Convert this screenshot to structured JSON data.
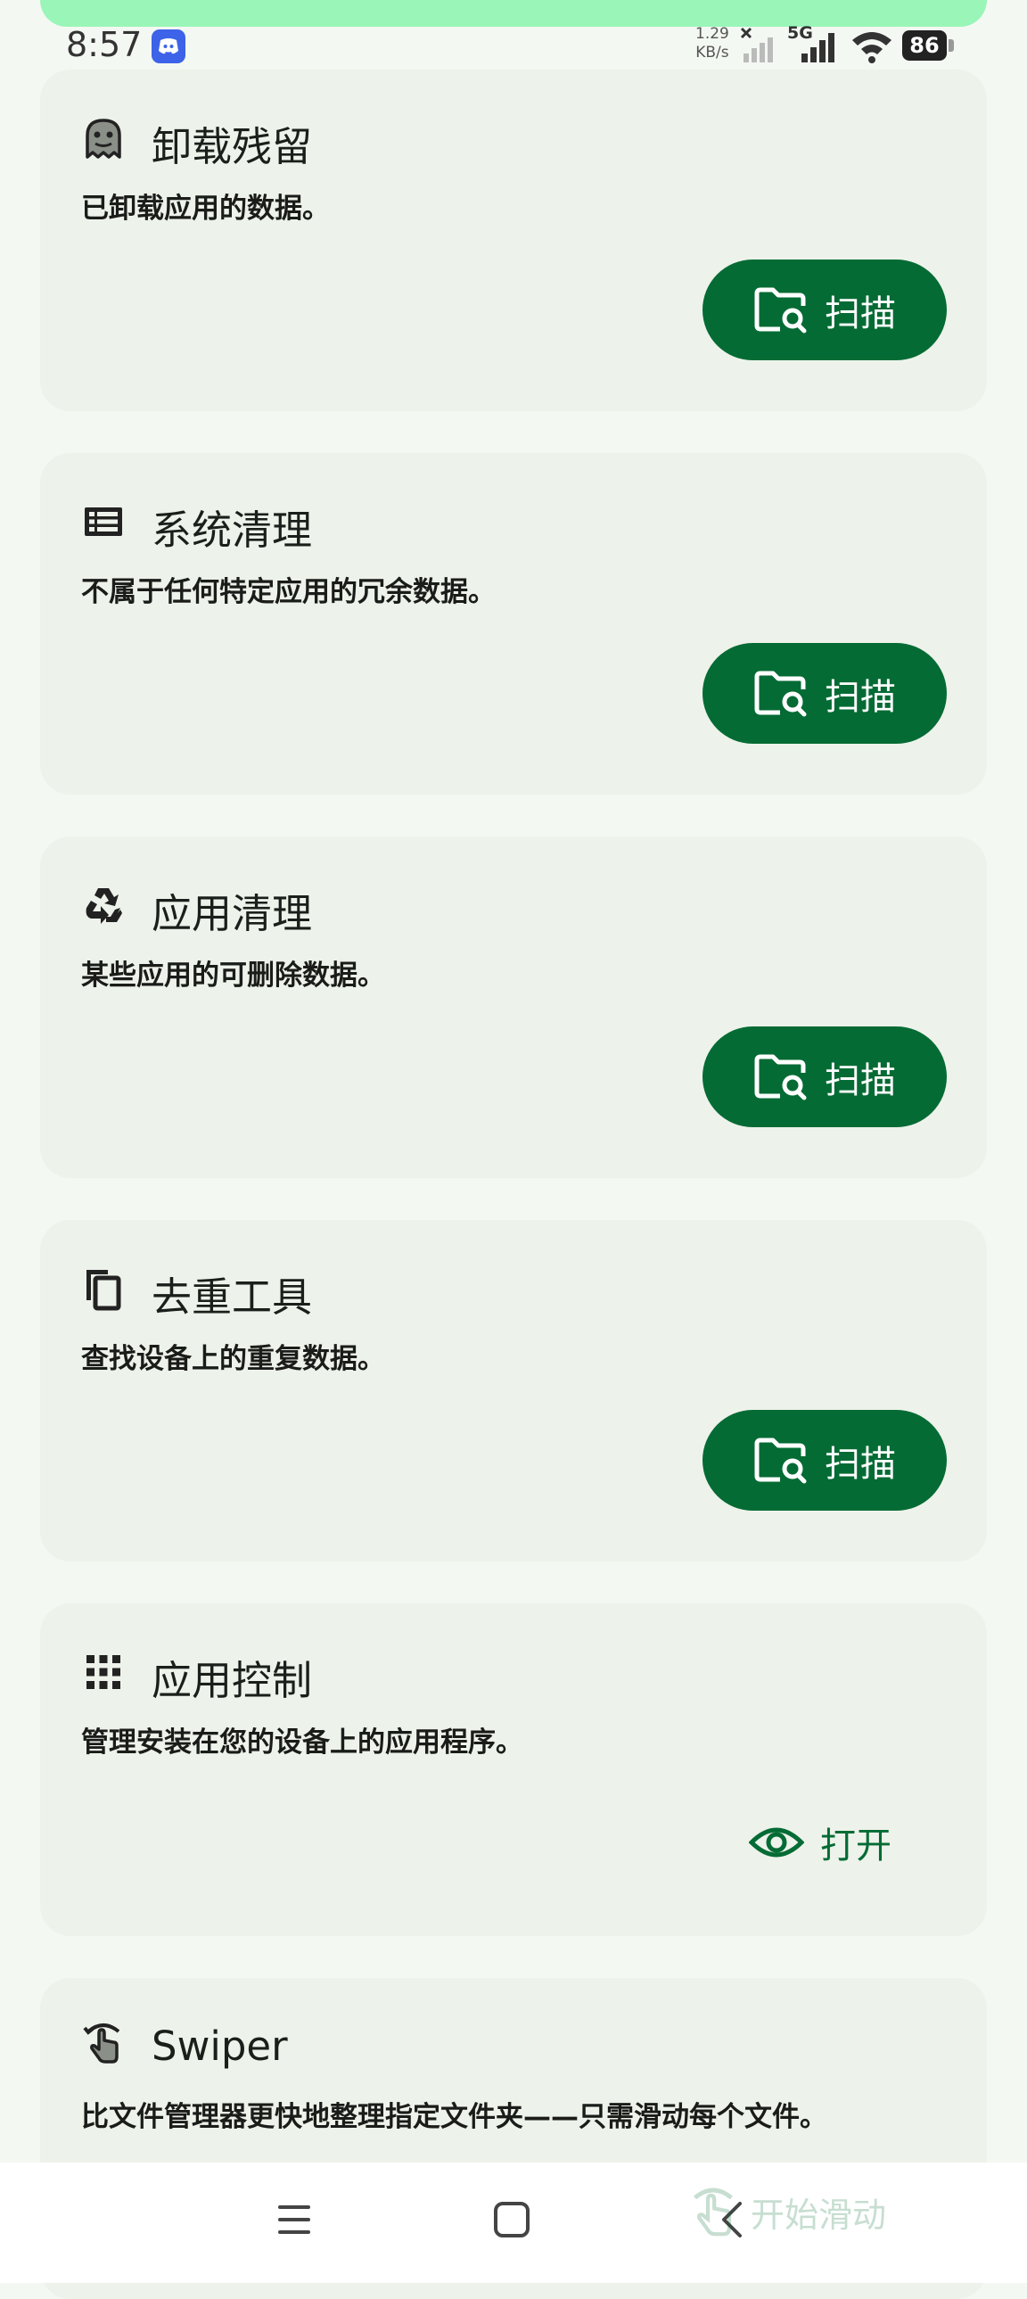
{
  "status_bar": {
    "time": "8:57",
    "net_speed_value": "1.29",
    "net_speed_unit": "KB/s",
    "network_type": "5G",
    "battery": "86"
  },
  "cards": [
    {
      "icon": "ghost-icon",
      "title": "卸载残留",
      "description": "已卸载应用的数据。",
      "action": "扫描"
    },
    {
      "icon": "list-icon",
      "title": "系统清理",
      "description": "不属于任何特定应用的冗余数据。",
      "action": "扫描"
    },
    {
      "icon": "recycle-icon",
      "title": "应用清理",
      "description": "某些应用的可删除数据。",
      "action": "扫描"
    },
    {
      "icon": "copy-icon",
      "title": "去重工具",
      "description": "查找设备上的重复数据。",
      "action": "扫描"
    },
    {
      "icon": "apps-grid-icon",
      "title": "应用控制",
      "description": "管理安装在您的设备上的应用程序。",
      "action": "打开"
    },
    {
      "icon": "swipe-icon",
      "title": "Swiper",
      "description": "比文件管理器更快地整理指定文件夹——只需滑动每个文件。"
    }
  ],
  "floating_action": {
    "label": "开始滑动"
  },
  "colors": {
    "accent": "#046b34",
    "card_bg": "#edf2ea",
    "page_bg": "#f4f8f2"
  }
}
